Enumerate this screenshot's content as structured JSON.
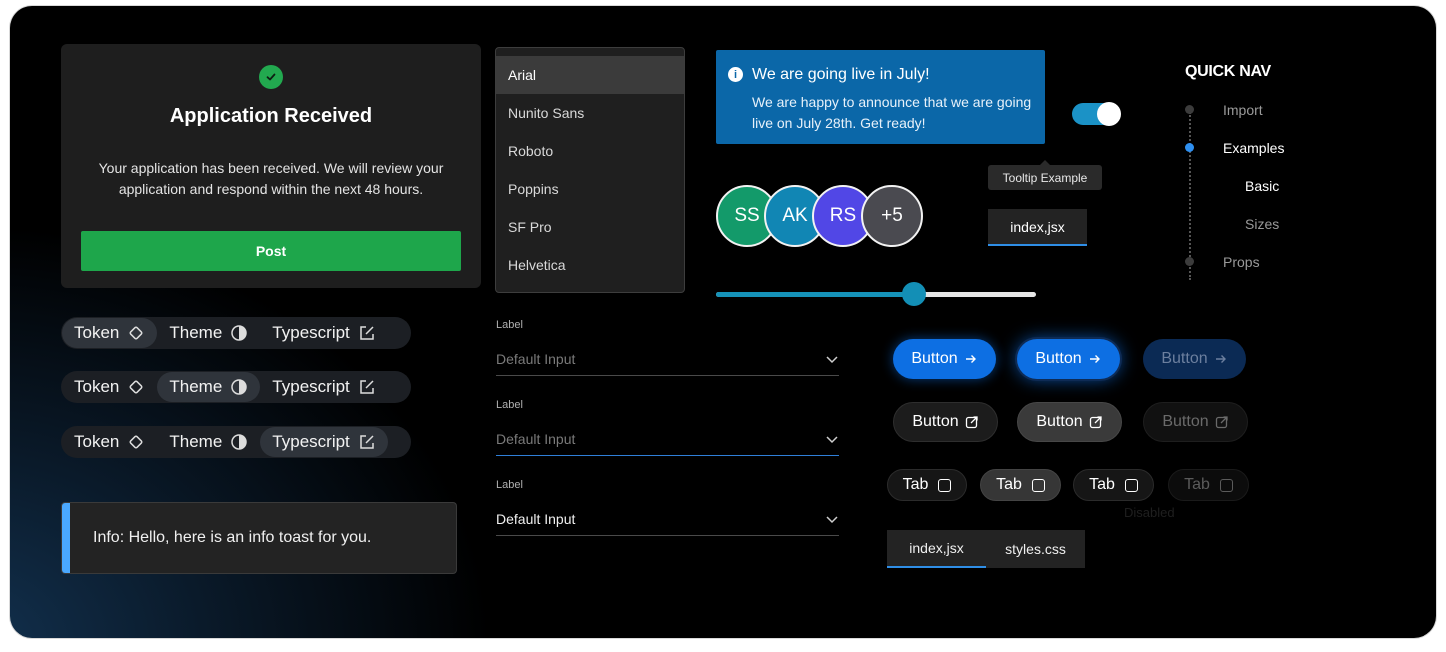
{
  "success_card": {
    "title": "Application Received",
    "message": "Your application has been received. We will review your application and respond within the next 48 hours.",
    "button_label": "Post"
  },
  "segmented_controls": [
    {
      "items": [
        "Token",
        "Theme",
        "Typescript"
      ],
      "active": 0
    },
    {
      "items": [
        "Token",
        "Theme",
        "Typescript"
      ],
      "active": 1
    },
    {
      "items": [
        "Token",
        "Theme",
        "Typescript"
      ],
      "active": 2
    }
  ],
  "toast": {
    "text": "Info: Hello, here is an info toast for you.",
    "accent": "#4aa8ff"
  },
  "font_dropdown": {
    "options": [
      "Arial",
      "Nunito Sans",
      "Roboto",
      "Poppins",
      "SF Pro",
      "Helvetica"
    ],
    "selected": "Arial"
  },
  "inputs": [
    {
      "label": "Label",
      "placeholder": "Default Input",
      "value": "",
      "state": "default"
    },
    {
      "label": "Label",
      "placeholder": "Default Input",
      "value": "",
      "state": "focused"
    },
    {
      "label": "Label",
      "placeholder": "Default Input",
      "value": "Default Input",
      "state": "filled"
    }
  ],
  "banner": {
    "title": "We are going live in July!",
    "body": "We are happy to announce that we are going live on July 28th. Get ready!",
    "color": "#0b67a8"
  },
  "toggle": {
    "on": true
  },
  "tooltip": {
    "text": "Tooltip Example"
  },
  "file_tab": {
    "label": "index,jsx"
  },
  "avatars": [
    {
      "initials": "SS",
      "color": "#139a6a"
    },
    {
      "initials": "AK",
      "color": "#1186b4"
    },
    {
      "initials": "RS",
      "color": "#5147e6"
    },
    {
      "initials": "+5",
      "color": "#4a4a50"
    }
  ],
  "slider": {
    "value": 0.62
  },
  "quick_nav": {
    "title": "QUICK NAV",
    "items": [
      {
        "label": "Import",
        "level": 0,
        "active": false
      },
      {
        "label": "Examples",
        "level": 0,
        "active": true
      },
      {
        "label": "Basic",
        "level": 1,
        "active": false
      },
      {
        "label": "Sizes",
        "level": 1,
        "active": false
      },
      {
        "label": "Props",
        "level": 0,
        "active": false
      }
    ]
  },
  "buttons": {
    "primary": [
      "Button",
      "Button",
      "Button"
    ],
    "secondary": [
      "Button",
      "Button",
      "Button"
    ]
  },
  "tabs": {
    "labels": [
      "Tab",
      "Tab",
      "Tab",
      "Tab"
    ],
    "disabled_label": "Disabled"
  },
  "tabbar": {
    "items": [
      "index,jsx",
      "styles.css"
    ],
    "active": 0
  }
}
